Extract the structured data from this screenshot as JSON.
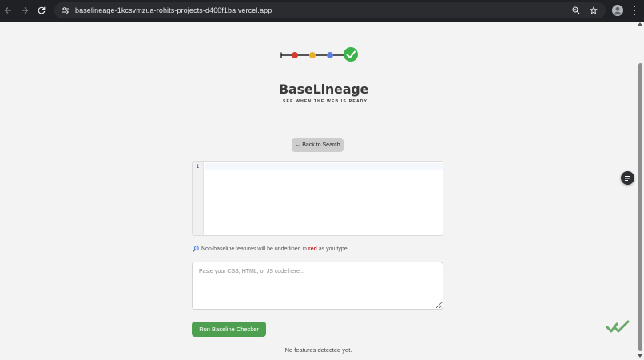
{
  "browser": {
    "url": "baselineage-1kcsvmzua-rohits-projects-d460f1ba.vercel.app",
    "icons": {
      "back": "arrow-left-icon",
      "forward": "arrow-right-icon",
      "reload": "reload-icon",
      "site_info": "tune-icon",
      "zoom": "magnifier-icon",
      "bookmark": "star-icon",
      "profile": "avatar-icon",
      "menu": "kebab-icon"
    }
  },
  "brand": {
    "name": "BaseLineage",
    "tagline": "SEE WHEN THE WEB IS READY",
    "dot_colors": [
      "#d63b2f",
      "#e8b026",
      "#5b7fde",
      "#3cb44b"
    ]
  },
  "back_button": {
    "label": "← Back to Search"
  },
  "editor": {
    "line_numbers": [
      "1"
    ]
  },
  "hint": {
    "before": "Non-baseline features will be underlined in",
    "highlight": "red",
    "after": "as you type.",
    "icon": "magnifier-icon"
  },
  "code_input": {
    "placeholder": "Paste your CSS, HTML, or JS code here...",
    "value": ""
  },
  "run_button": {
    "label": "Run Baseline Checker"
  },
  "status": {
    "text": "No features detected yet."
  },
  "colors": {
    "accent_green": "#4e9f50",
    "highlight_red": "#c62828"
  }
}
